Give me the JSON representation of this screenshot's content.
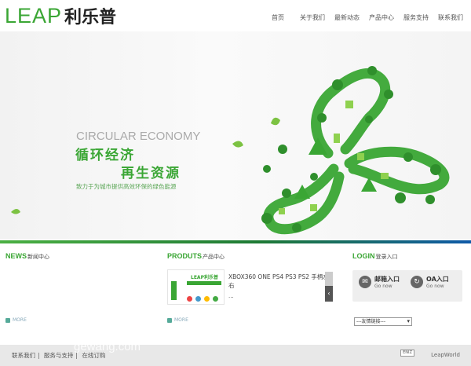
{
  "header": {
    "logo_en": "LEAP",
    "logo_cn": "利乐普",
    "nav": [
      "首页",
      "关于我们",
      "最新动态",
      "产品中心",
      "服务支持",
      "联系我们"
    ]
  },
  "banner": {
    "en_title": "CIRCULAR ECONOMY",
    "title1": "循环经济",
    "title2": "再生资源",
    "tagline": "致力于为城市提供高效环保的绿色能源"
  },
  "news": {
    "title": "NEWS",
    "title_cn": "新闻中心",
    "more": "MORE"
  },
  "products": {
    "title": "PRODUTS",
    "title_cn": "产品中心",
    "more": "MORE",
    "item_name": "XBOX360 ONE PS4 PS3 PS2 手柄左右",
    "item_more": "...",
    "thumb_brand": "LEAP利乐普"
  },
  "login": {
    "title": "LOGIN",
    "title_cn": "登录入口",
    "mail_label": "邮箱入口",
    "mail_go": "Go now",
    "oa_label": "OA入口",
    "oa_go": "Go now",
    "links_select": "---友情链接---"
  },
  "footer": {
    "links": [
      "联系我们",
      "服务与支持",
      "在线订购"
    ],
    "badge": "ENIZ",
    "right": "LeapWorld",
    "watermark": "gewang.com"
  },
  "colors": {
    "accent": "#3aa634",
    "bar_end": "#0f5aa8"
  }
}
